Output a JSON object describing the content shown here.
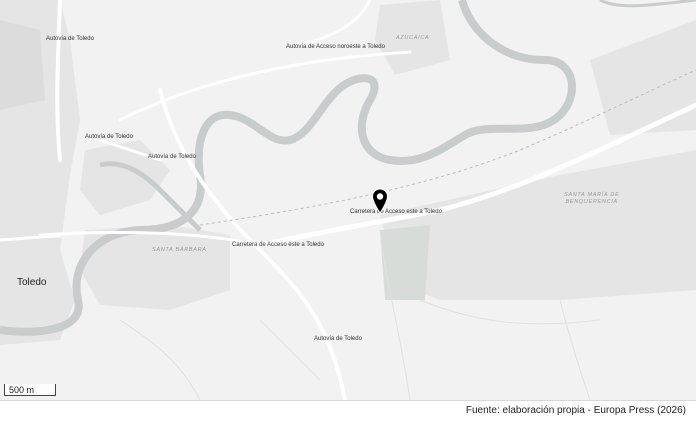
{
  "map": {
    "road_labels": [
      "Autovía de Toledo",
      "Autovía de Acceso noroeste a Toledo",
      "Autovía de Toledo",
      "Autovía de Toledo",
      "Carretera de Acceso este a Toledo",
      "Carretera de Acceso este a Toledo",
      "Autovía de Toledo"
    ],
    "area_labels": {
      "azucaica": "AZUCAICA",
      "santa_barbara": "SANTA BÁRBARA",
      "santa_maria_line1": "SANTA MARÍA DE",
      "santa_maria_line2": "BENQUERENCIA"
    },
    "city_label": "Toledo",
    "marker_icon": "map-pin-icon",
    "scale_label": "500 m",
    "colors": {
      "background": "#f2f2f2",
      "river": "#c8cccc",
      "roads": "#ffffff",
      "built_area": "#e4e4e4",
      "park": "#d9ddda",
      "marker": "#000000"
    }
  },
  "footer": {
    "source": "Fuente: elaboración propia - Europa Press (2026)"
  }
}
